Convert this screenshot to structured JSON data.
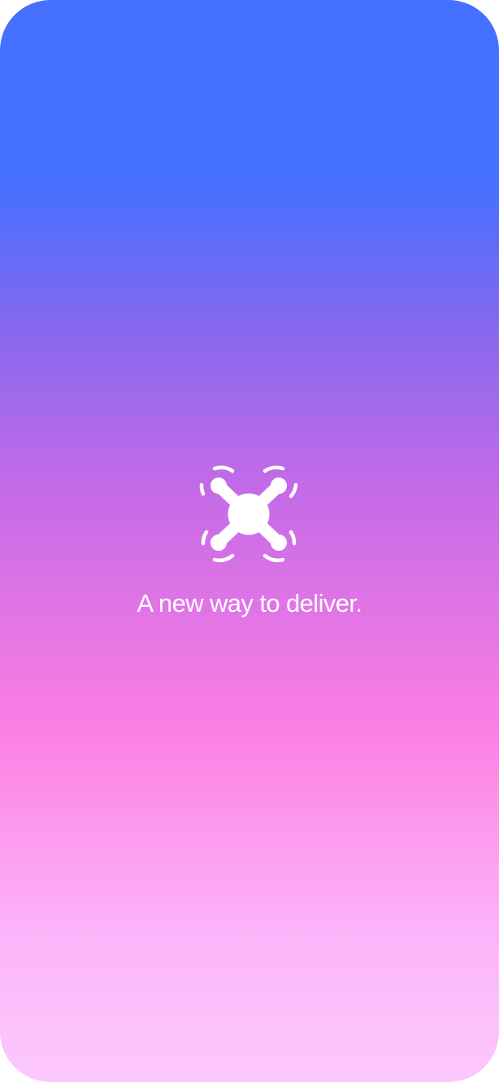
{
  "splash": {
    "logo_icon": "drone-icon",
    "tagline": "A new way to deliver.",
    "gradient_colors": [
      "#4670ff",
      "#8668ef",
      "#c46ae8",
      "#fc80e4",
      "#fcb6fa",
      "#fcc8fc"
    ],
    "text_color": "#ffffff"
  }
}
